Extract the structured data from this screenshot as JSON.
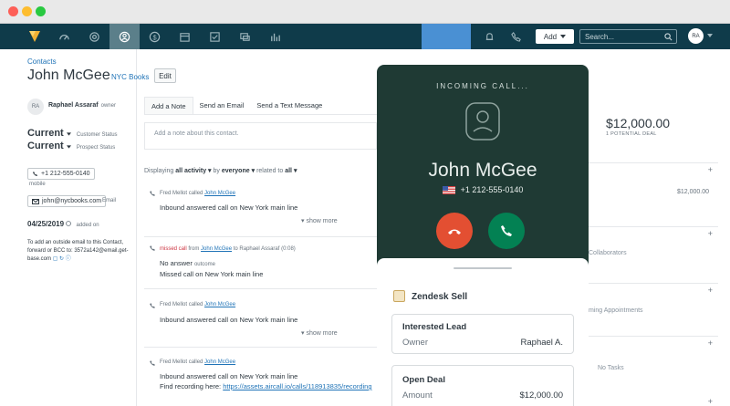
{
  "nav": {
    "add_label": "Add",
    "search_placeholder": "Search...",
    "avatar_initials": "RA",
    "icons": [
      "dashboard-icon",
      "leads-icon",
      "contacts-icon",
      "deals-icon",
      "calendar-icon",
      "tasks-icon",
      "communication-icon",
      "reports-icon",
      "notifications-icon",
      "phone-icon"
    ],
    "active_icon": "contacts-icon",
    "colors": {
      "bar": "#0f3b4a",
      "active": "#5b7f8a",
      "highlight": "#4a90d3"
    }
  },
  "contact": {
    "breadcrumb": "Contacts",
    "name": "John McGee",
    "company": "NYC Books",
    "edit_label": "Edit",
    "owner_initials": "RA",
    "owner_name": "Raphael Assaraf",
    "owner_role": "owner",
    "customer_status": "Current",
    "customer_status_label": "Customer Status",
    "prospect_status": "Current",
    "prospect_status_label": "Prospect Status",
    "phone": "+1 212-555-0140",
    "phone_type": "mobile",
    "email": "john@nycbooks.com",
    "email_type": "Email",
    "added_date": "04/25/2019",
    "added_label": "added on",
    "bcc_text": "To add an outside email to this Contact, forward or BCC to: 3572a142@email.get-base.com"
  },
  "feed": {
    "tabs": [
      {
        "label": "Add a Note",
        "active": true
      },
      {
        "label": "Send an Email",
        "active": false
      },
      {
        "label": "Send a Text Message",
        "active": false
      }
    ],
    "note_placeholder": "Add a note about this contact.",
    "filter": {
      "prefix": "Displaying",
      "activity": "all activity",
      "by": "by",
      "who": "everyone",
      "related": "related to",
      "related_value": "all"
    },
    "items": [
      {
        "actor": "Fred Mellot",
        "verb": "called",
        "target": "John McGee",
        "line1": "Inbound answered call on New York main line",
        "show_more": "show more"
      },
      {
        "actor": "",
        "verb": "missed call",
        "from": "from",
        "target": "John McGee",
        "to": "to Raphael Assaraf (0:08)",
        "outcome": "No answer",
        "outcome_label": "outcome",
        "line1": "Missed call on New York main line"
      },
      {
        "actor": "Fred Mellot",
        "verb": "called",
        "target": "John McGee",
        "line1": "Inbound answered call on New York main line",
        "show_more": "show more"
      },
      {
        "actor": "Fred Mellot",
        "verb": "called",
        "target": "John McGee",
        "line1": "Inbound answered call on New York main line",
        "line2_prefix": "Find recording here:",
        "line2_link": "https://assets.aircall.io/calls/118913835/recording"
      }
    ]
  },
  "right_panel": {
    "deal_amount": "$12,000.00",
    "deal_sub": "1 POTENTIAL DEAL",
    "deal_row_value": "$12,000.00",
    "collaborators": "Collaborators",
    "appointments": "ming Appointments",
    "tasks": "No Tasks"
  },
  "call": {
    "title": "INCOMING CALL...",
    "name": "John McGee",
    "phone": "+1 212-555-0140",
    "integration": "Zendesk Sell",
    "lead": {
      "title": "Interested Lead",
      "key": "Owner",
      "value": "Raphael A."
    },
    "deal": {
      "title": "Open Deal",
      "key": "Amount",
      "value": "$12,000.00"
    },
    "colors": {
      "panel": "#1f3a34",
      "decline": "#e34f32",
      "accept": "#038153"
    }
  }
}
